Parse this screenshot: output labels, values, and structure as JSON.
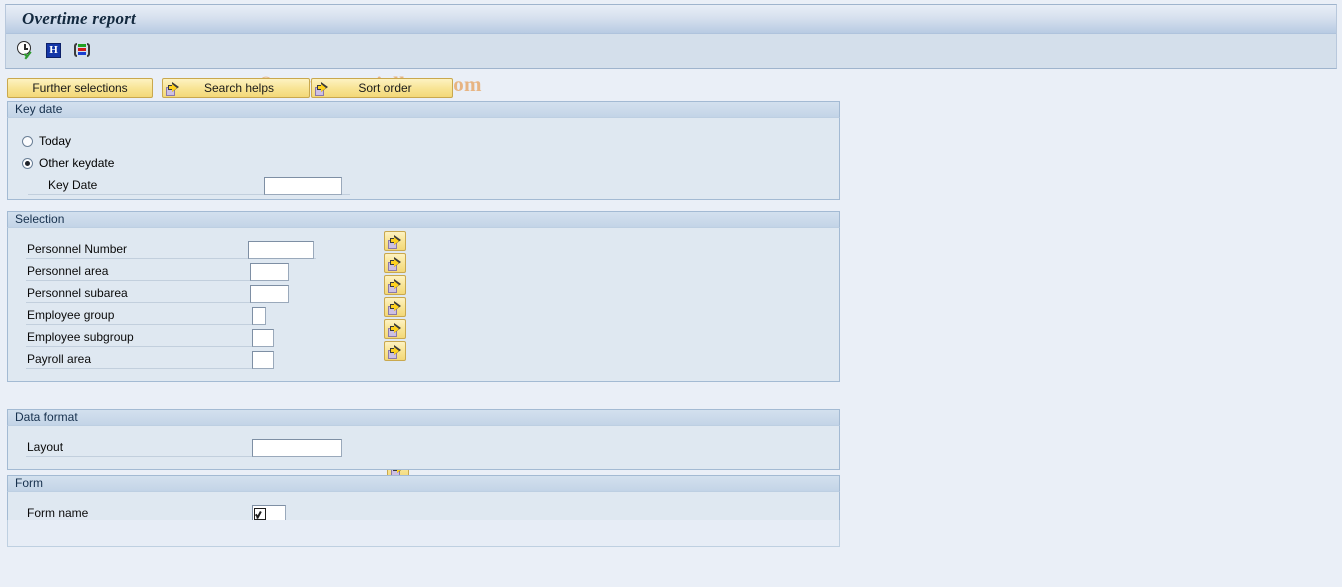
{
  "window": {
    "title": "Overtime report",
    "watermark": "© www.tutorialkart.com"
  },
  "toolbar": {
    "icons": [
      {
        "name": "execute-clock-icon",
        "label": "Execute"
      },
      {
        "name": "info-h-icon",
        "label": "Information"
      },
      {
        "name": "legend-icon",
        "label": "Legend"
      }
    ]
  },
  "buttons": {
    "further_selections": "Further selections",
    "search_helps": "Search helps",
    "sort_order": "Sort order"
  },
  "groups": {
    "key_date": {
      "title": "Key date",
      "options": [
        {
          "label": "Today",
          "selected": false
        },
        {
          "label": "Other keydate",
          "selected": true
        }
      ],
      "key_date_field": {
        "label": "Key Date",
        "value": ""
      }
    },
    "selection": {
      "title": "Selection",
      "fields": [
        {
          "label": "Personnel Number",
          "value": "",
          "input_width": 66,
          "has_multi": true
        },
        {
          "label": "Personnel area",
          "value": "",
          "input_width": 39,
          "has_multi": true
        },
        {
          "label": "Personnel subarea",
          "value": "",
          "input_width": 39,
          "has_multi": true
        },
        {
          "label": "Employee group",
          "value": "",
          "input_width": 14,
          "has_multi": true
        },
        {
          "label": "Employee subgroup",
          "value": "",
          "input_width": 22,
          "has_multi": true
        },
        {
          "label": "Payroll area",
          "value": "",
          "input_width": 22,
          "has_multi": true
        }
      ],
      "multi_select_icon": "multi-select-arrow-icon"
    },
    "data_format": {
      "title": "Data format",
      "fields": [
        {
          "label": "Layout",
          "value": "",
          "input_width": 90
        }
      ]
    },
    "form": {
      "title": "Form",
      "fields": [
        {
          "label": "Form name",
          "value": "",
          "input_width": 34,
          "glyph": "checkbox-check-icon"
        }
      ]
    }
  },
  "colors": {
    "accent_button": "#f8e495",
    "panel_bg": "#dfe8f1",
    "page_bg": "#eaeff7",
    "title_text": "#13293f",
    "watermark": "#e7b482"
  }
}
